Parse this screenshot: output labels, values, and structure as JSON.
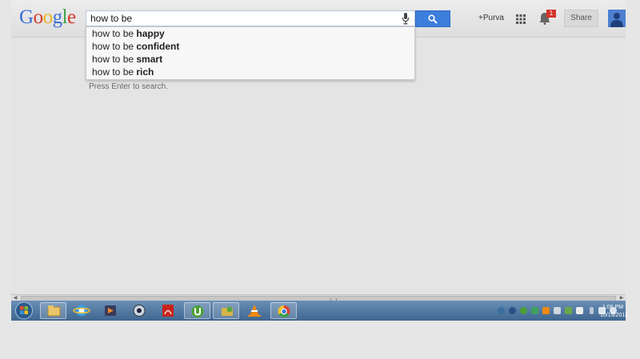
{
  "logo": {
    "g": "G",
    "o1": "o",
    "o2": "o",
    "g2": "g",
    "l": "l",
    "e": "e"
  },
  "search": {
    "value": "how to be "
  },
  "suggestions": [
    {
      "prefix": "how to be ",
      "completion": "happy"
    },
    {
      "prefix": "how to be ",
      "completion": "confident"
    },
    {
      "prefix": "how to be ",
      "completion": "smart"
    },
    {
      "prefix": "how to be ",
      "completion": "rich"
    }
  ],
  "hint": "Press Enter to search.",
  "header": {
    "user": "+Purva",
    "notification_count": "1",
    "share_label": "Share"
  },
  "taskbar": {
    "apps": [
      "windows-explorer",
      "internet-explorer",
      "media-player",
      "quicktime",
      "adobe-reader",
      "utorrent",
      "file-manager",
      "vlc",
      "chrome"
    ],
    "time": "1:06 PM",
    "date": "10/15/2013"
  },
  "colors": {
    "search_button": "#3d7ddc",
    "badge": "#d4342b",
    "taskbar": "#4a719b"
  }
}
